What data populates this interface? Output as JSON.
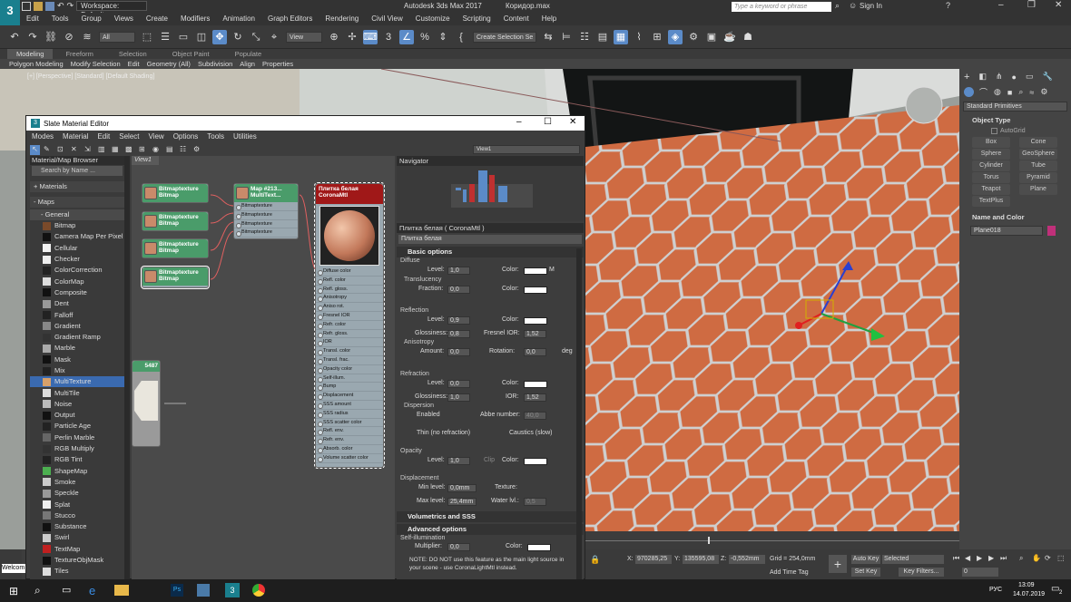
{
  "titlebar": {
    "workspace": "Workspace: Default",
    "app_title": "Autodesk 3ds Max 2017",
    "file": "Коридор.max",
    "search_placeholder": "Type a keyword or phrase",
    "signin": "Sign In"
  },
  "menus": [
    "Edit",
    "Tools",
    "Group",
    "Views",
    "Create",
    "Modifiers",
    "Animation",
    "Graph Editors",
    "Rendering",
    "Civil View",
    "Customize",
    "Scripting",
    "Content",
    "Help"
  ],
  "toolbar": {
    "filter": "All",
    "view": "View",
    "selection_set": "Create Selection Se"
  },
  "ribbon": {
    "tabs": [
      "Modeling",
      "Freeform",
      "Selection",
      "Object Paint",
      "Populate"
    ],
    "items": [
      "Polygon Modeling",
      "Modify Selection",
      "Edit",
      "Geometry (All)",
      "Subdivision",
      "Align",
      "Properties"
    ]
  },
  "viewport": {
    "label": "[+] [Perspective] [Standard] [Default Shading]"
  },
  "slate": {
    "title": "Slate Material Editor",
    "menus": [
      "Modes",
      "Material",
      "Edit",
      "Select",
      "View",
      "Options",
      "Tools",
      "Utilities"
    ],
    "view_dropdown": "View1",
    "browser": {
      "title": "Material/Map Browser",
      "search": "Search by Name ...",
      "sections": [
        "+ Materials",
        "- Maps",
        "- General"
      ],
      "items": [
        {
          "label": "Bitmap",
          "color": "#7a4a2a"
        },
        {
          "label": "Camera Map Per Pixel",
          "color": "#111"
        },
        {
          "label": "Cellular",
          "color": "#f2f2f2"
        },
        {
          "label": "Checker",
          "color": "#eee"
        },
        {
          "label": "ColorCorrection",
          "color": "#222"
        },
        {
          "label": "ColorMap",
          "color": "#ddd"
        },
        {
          "label": "Composite",
          "color": "#111"
        },
        {
          "label": "Dent",
          "color": "#999"
        },
        {
          "label": "Falloff",
          "color": "#222"
        },
        {
          "label": "Gradient",
          "color": "#888"
        },
        {
          "label": "Gradient Ramp",
          "color": "#333"
        },
        {
          "label": "Marble",
          "color": "#aaa"
        },
        {
          "label": "Mask",
          "color": "#111"
        },
        {
          "label": "Mix",
          "color": "#222"
        },
        {
          "label": "MultiTexture",
          "color": "#d6a06a"
        },
        {
          "label": "MultiTile",
          "color": "#ddd"
        },
        {
          "label": "Noise",
          "color": "#bbb"
        },
        {
          "label": "Output",
          "color": "#111"
        },
        {
          "label": "Particle Age",
          "color": "#222"
        },
        {
          "label": "Perlin Marble",
          "color": "#666"
        },
        {
          "label": "RGB Multiply",
          "color": "#333"
        },
        {
          "label": "RGB Tint",
          "color": "#222"
        },
        {
          "label": "ShapeMap",
          "color": "#4caf50"
        },
        {
          "label": "Smoke",
          "color": "#ccc"
        },
        {
          "label": "Speckle",
          "color": "#999"
        },
        {
          "label": "Splat",
          "color": "#eee"
        },
        {
          "label": "Stucco",
          "color": "#777"
        },
        {
          "label": "Substance",
          "color": "#111"
        },
        {
          "label": "Swirl",
          "color": "#ccc"
        },
        {
          "label": "TextMap",
          "color": "#c02020"
        },
        {
          "label": "TextureObjMask",
          "color": "#111"
        },
        {
          "label": "Tiles",
          "color": "#ddd"
        }
      ]
    },
    "view_tab": "View1",
    "nodes": {
      "bitmap_title": "Bitmaptexture",
      "bitmap_sub": "Bitmap",
      "multi_title": "Map #213...",
      "multi_sub": "MultiText...",
      "multi_slots": [
        "Bitmaptexture",
        "Bitmaptexture",
        "Bitmaptexture",
        "Bitmaptexture"
      ],
      "mat_title": "Плитка белая",
      "mat_sub": "CoronaMtl",
      "small_node": "5487",
      "mat_slots": [
        "Diffuse color",
        "Refl. color",
        "Refl. gloss.",
        "Anisotropy",
        "Aniso rot.",
        "Fresnel IOR",
        "Refr. color",
        "Refr. gloss.",
        "IOR",
        "Transl. color",
        "Transl. frac.",
        "Opacity color",
        "Self-illum.",
        "Bump",
        "Displacement",
        "SSS amount",
        "SSS radius",
        "SSS scatter color",
        "Refl. env.",
        "Refr. env.",
        "Absorb. color",
        "Volume scatter color"
      ]
    },
    "navigator": "Navigator",
    "params": {
      "header": "Плитка белая ( CoronaMtl )",
      "name": "Плитка белая",
      "basic": "Basic options",
      "diffuse": "Diffuse",
      "level": "Level:",
      "color": "Color:",
      "diff_level": "1,0",
      "m": "M",
      "translucency": "Translucency",
      "fraction": "Fraction:",
      "frac_val": "0,0",
      "reflection": "Reflection",
      "refl_level": "0,9",
      "glossiness": "Glossiness:",
      "refl_gloss": "0,8",
      "fresnel": "Fresnel IOR:",
      "fresnel_val": "1,52",
      "anisotropy": "Anisotropy",
      "amount": "Amount:",
      "amount_val": "0,0",
      "rotation": "Rotation:",
      "rot_val": "0,0",
      "deg": "deg",
      "refraction": "Refraction",
      "refr_level": "0,0",
      "refr_gloss": "1,0",
      "ior": "IOR:",
      "ior_val": "1,52",
      "dispersion": "Dispersion",
      "enabled": "Enabled",
      "abbe": "Abbe number:",
      "abbe_val": "40,0",
      "thin": "Thin (no refraction)",
      "caustics": "Caustics (slow)",
      "opacity": "Opacity",
      "op_level": "1,0",
      "clip": "Clip",
      "displacement": "Displacement",
      "min_level": "Min level:",
      "min_val": "0,0mm",
      "texture": "Texture:",
      "max_level": "Max level:",
      "max_val": "25,4mm",
      "water": "Water lvl.:",
      "water_val": "0,5",
      "vol": "Volumetrics and SSS",
      "adv": "Advanced options",
      "selfillum": "Self-illumination",
      "multiplier": "Multiplier:",
      "mult_val": "0,0",
      "note1": "NOTE: DO NOT use this feature as the main light source in",
      "note2": "your scene - use CoronaLightMtl instead."
    }
  },
  "cmdpanel": {
    "dropdown": "Standard Primitives",
    "object_type": "Object Type",
    "autogrid": "AutoGrid",
    "buttons": [
      "Box",
      "Cone",
      "Sphere",
      "GeoSphere",
      "Cylinder",
      "Tube",
      "Torus",
      "Pyramid",
      "Teapot",
      "Plane",
      "TextPlus"
    ],
    "name_color": "Name and Color",
    "name_value": "Plane018",
    "obj_color": "#c0307a"
  },
  "status": {
    "x_label": "X:",
    "x": "970285,25",
    "y_label": "Y:",
    "y": "135595,08",
    "z_label": "Z:",
    "z": "-0,552mm",
    "grid": "Grid = 254,0mm",
    "add_time_tag": "Add Time Tag",
    "auto_key": "Auto Key",
    "selected": "Selected",
    "set_key": "Set Key",
    "key_filters": "Key Filters...",
    "frame": "0",
    "welcome": "Welcom"
  },
  "taskbar": {
    "lang": "РУС",
    "time": "13:09",
    "date": "14.07.2019",
    "notif": "2"
  }
}
